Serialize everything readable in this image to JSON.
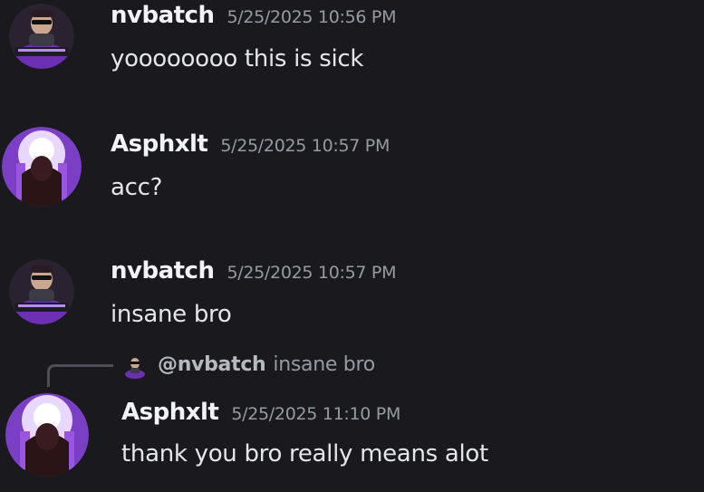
{
  "messages": [
    {
      "username": "nvbatch",
      "timestamp": "5/25/2025 10:56 PM",
      "content": "yoooooooo this is sick",
      "avatar_icon": "nvbatch-avatar-icon"
    },
    {
      "username": "Asphxlt",
      "timestamp": "5/25/2025 10:57 PM",
      "content": "acc?",
      "avatar_icon": "asphxlt-avatar-icon"
    },
    {
      "username": "nvbatch",
      "timestamp": "5/25/2025 10:57 PM",
      "content": "insane bro",
      "avatar_icon": "nvbatch-avatar-icon"
    },
    {
      "username": "Asphxlt",
      "timestamp": "5/25/2025 11:10 PM",
      "content": "thank you bro really means alot",
      "avatar_icon": "asphxlt-avatar-icon",
      "reply": {
        "mention": "@nvbatch",
        "text": "insane bro"
      }
    }
  ],
  "colors": {
    "background": "#1a1a1e",
    "username": "#f2f3f5",
    "timestamp": "#949ba4",
    "accent_purple": "#8a3fd6"
  }
}
